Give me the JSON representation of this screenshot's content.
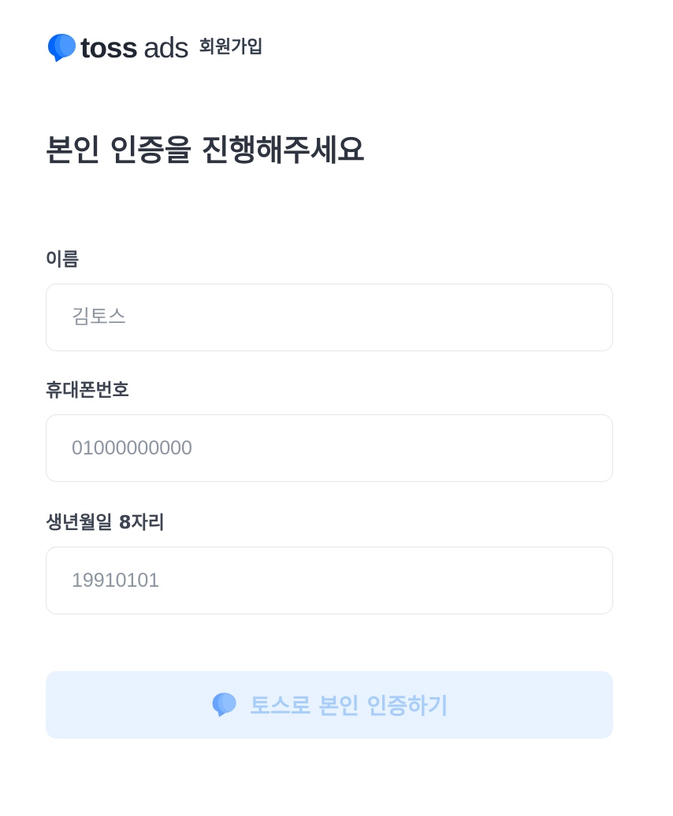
{
  "header": {
    "brand_bold": "toss",
    "brand_light": "ads",
    "section_label": "회원가입"
  },
  "page_title": "본인 인증을 진행해주세요",
  "form": {
    "name": {
      "label": "이름",
      "placeholder": "김토스",
      "value": ""
    },
    "phone": {
      "label": "휴대폰번호",
      "placeholder": "01000000000",
      "value": ""
    },
    "birth": {
      "label": "생년월일 8자리",
      "placeholder": "19910101",
      "value": ""
    }
  },
  "submit": {
    "label": "토스로 본인 인증하기",
    "icon": "toss-logo-icon",
    "disabled": true
  },
  "colors": {
    "brand_blue": "#0064FF",
    "button_bg_disabled": "#E8F3FF",
    "button_text_disabled": "#A6CDFB",
    "placeholder": "#8B95A1",
    "input_border": "#E3E6EA"
  }
}
